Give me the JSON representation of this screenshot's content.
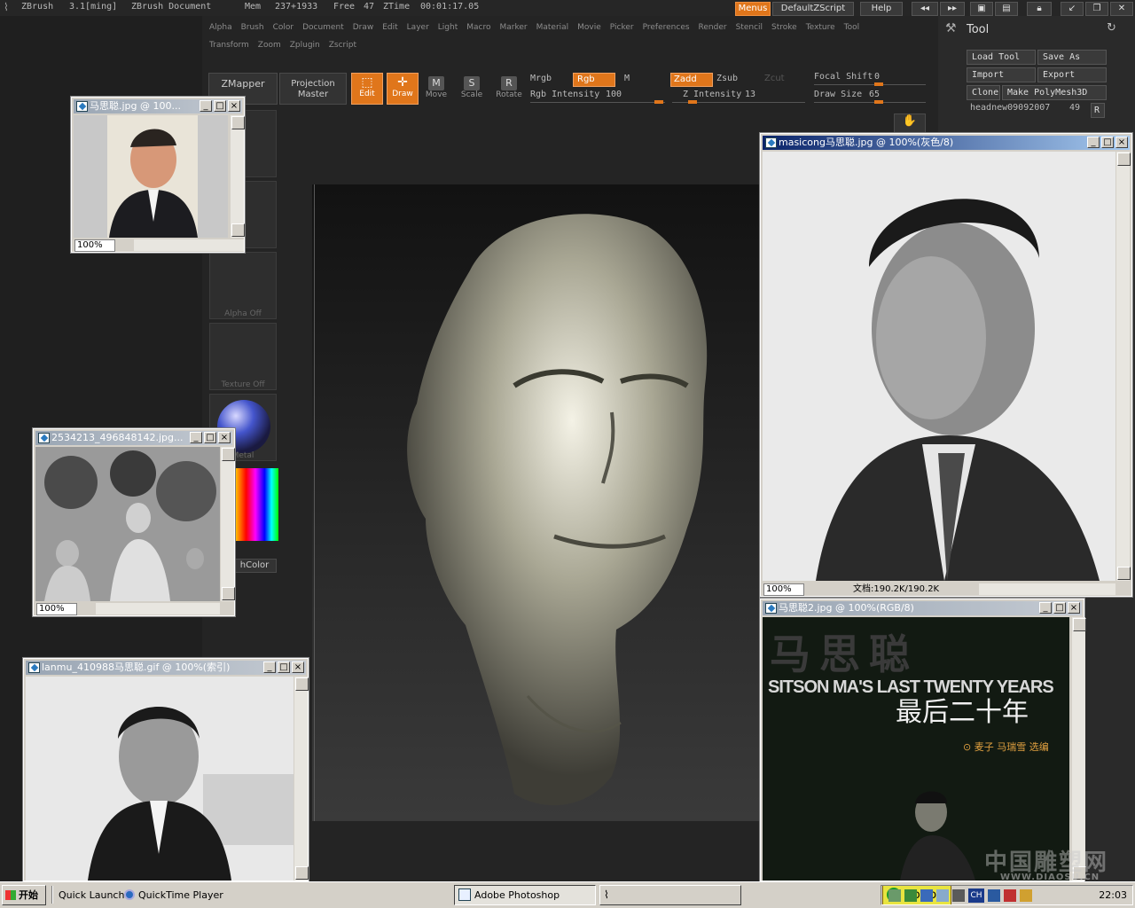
{
  "zbrush": {
    "app_name": "ZBrush",
    "version": "3.1[ming]",
    "document": "ZBrush Document",
    "mem_label": "Mem",
    "mem_value": "237+1933",
    "free_label": "Free",
    "free_value": "47",
    "ztime_label": "ZTime",
    "ztime_value": "00:01:17.05",
    "top_buttons": {
      "menus": "Menus",
      "default_zscript": "DefaultZScript",
      "help": "Help"
    },
    "menu_row1": [
      "Alpha",
      "Brush",
      "Color",
      "Document",
      "Draw",
      "Edit",
      "Layer",
      "Light",
      "Macro",
      "Marker",
      "Material",
      "Movie",
      "Picker",
      "Preferences",
      "Render",
      "Stencil",
      "Stroke",
      "Texture",
      "Tool"
    ],
    "menu_row2": [
      "Transform",
      "Zoom",
      "Zplugin",
      "Zscript"
    ],
    "toolbar": {
      "zmapper": "ZMapper",
      "projection_master": [
        "Projection",
        "Master"
      ],
      "edit": "Edit",
      "draw": "Draw",
      "move": "Move",
      "scale": "Scale",
      "rotate": "Rotate",
      "mrgb": "Mrgb",
      "rgb": "Rgb",
      "m": "M",
      "rgb_intensity_label": "Rgb Intensity",
      "rgb_intensity_value": "100",
      "zadd": "Zadd",
      "zsub": "Zsub",
      "zcut": "Zcut",
      "z_intensity_label": "Z Intensity",
      "z_intensity_value": "13",
      "focal_shift_label": "Focal Shift",
      "focal_shift_value": "0",
      "draw_size_label": "Draw Size",
      "draw_size_value": "65"
    },
    "left_palette": {
      "alpha": "Alpha Off",
      "texture": "Texture Off",
      "material": "Metal",
      "switch_color": "hColor"
    },
    "tool_panel": {
      "title": "Tool",
      "load_tool": "Load Tool",
      "save_as": "Save As",
      "import": "Import",
      "export": "Export",
      "clone": "Clone",
      "make_polymesh": "Make PolyMesh3D",
      "current_tool": "headnew09092007",
      "current_tool_count": "49",
      "r": "R"
    },
    "colors": {
      "accent": "#e0761b",
      "panel": "#2a2a2a"
    }
  },
  "windows": [
    {
      "title": "马思聪.jpg @ 100...",
      "zoom": "100%"
    },
    {
      "title": "2534213_496848142.jpg...",
      "zoom": "100%"
    },
    {
      "title": "lanmu_410988马思聪.gif @ 100%(索引)"
    },
    {
      "title": "masicong马思聪.jpg @ 100%(灰色/8)",
      "zoom": "100%",
      "status": "文档:190.2K/190.2K"
    },
    {
      "title": "马思聪2.jpg @ 100%(RGB/8)",
      "cover_title_cn": "马思聪",
      "cover_title_en": "SITSON MA'S LAST TWENTY YEARS",
      "cover_subtitle_cn": "最后二十年",
      "cover_editors": "⊙ 麦子 马瑞雪 选编"
    }
  ],
  "taskbar": {
    "start": "开始",
    "quick_launch": "Quick Launch",
    "quicktime": "QuickTime Player",
    "photoshop": "Adobe Photoshop",
    "norton": "Norton",
    "ch": "CH",
    "clock": "22:03"
  },
  "watermark": {
    "cn": "中国雕塑网",
    "url": "WWW.DIAOSU.CN"
  }
}
